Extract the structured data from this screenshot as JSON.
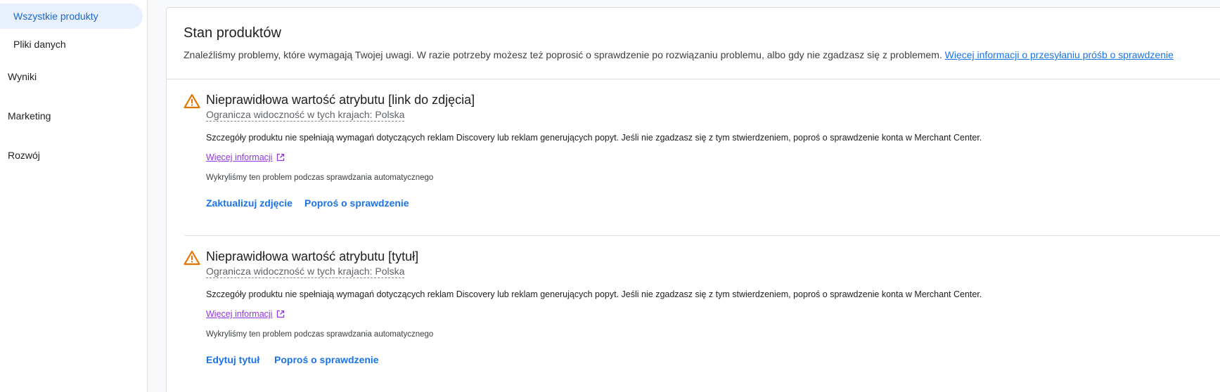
{
  "sidebar": {
    "sub_items": [
      {
        "label": "Wszystkie produkty",
        "active": true
      },
      {
        "label": "Pliki danych",
        "active": false
      }
    ],
    "top_items": [
      {
        "label": "Wyniki"
      },
      {
        "label": "Marketing"
      },
      {
        "label": "Rozwój"
      }
    ]
  },
  "card": {
    "title": "Stan produktów",
    "description": "Znaleźliśmy problemy, które wymagają Twojej uwagi. W razie potrzeby możesz też poprosić o sprawdzenie po rozwiązaniu problemu, albo gdy nie zgadzasz się z problemem.",
    "description_link": "Więcej informacji o przesyłaniu próśb o sprawdzenie"
  },
  "issues": [
    {
      "icon": "warning-icon",
      "title": "Nieprawidłowa wartość atrybutu [link do zdjęcia]",
      "subtitle": "Ogranicza widoczność w tych krajach: Polska",
      "body": "Szczegóły produktu nie spełniają wymagań dotyczących reklam Discovery lub reklam generujących popyt. Jeśli nie zgadzasz się z tym stwierdzeniem, poproś o sprawdzenie konta w Merchant Center.",
      "more_link": "Więcej informacji",
      "meta": "Wykryliśmy ten problem podczas sprawdzania automatycznego",
      "primary_action": "Zaktualizuj zdjęcie",
      "secondary_action": "Poproś o sprawdzenie"
    },
    {
      "icon": "warning-icon",
      "title": "Nieprawidłowa wartość atrybutu [tytuł]",
      "subtitle": "Ogranicza widoczność w tych krajach: Polska",
      "body": "Szczegóły produktu nie spełniają wymagań dotyczących reklam Discovery lub reklam generujących popyt. Jeśli nie zgadzasz się z tym stwierdzeniem, poproś o sprawdzenie konta w Merchant Center.",
      "more_link": "Więcej informacji",
      "meta": "Wykryliśmy ten problem podczas sprawdzania automatycznego",
      "primary_action": "Edytuj tytuł",
      "secondary_action": "Poproś o sprawdzenie"
    }
  ],
  "colors": {
    "accent": "#1a73e8",
    "active_nav_bg": "#e8f0fe",
    "warning": "#e37400",
    "visited_link": "#9334e6"
  }
}
